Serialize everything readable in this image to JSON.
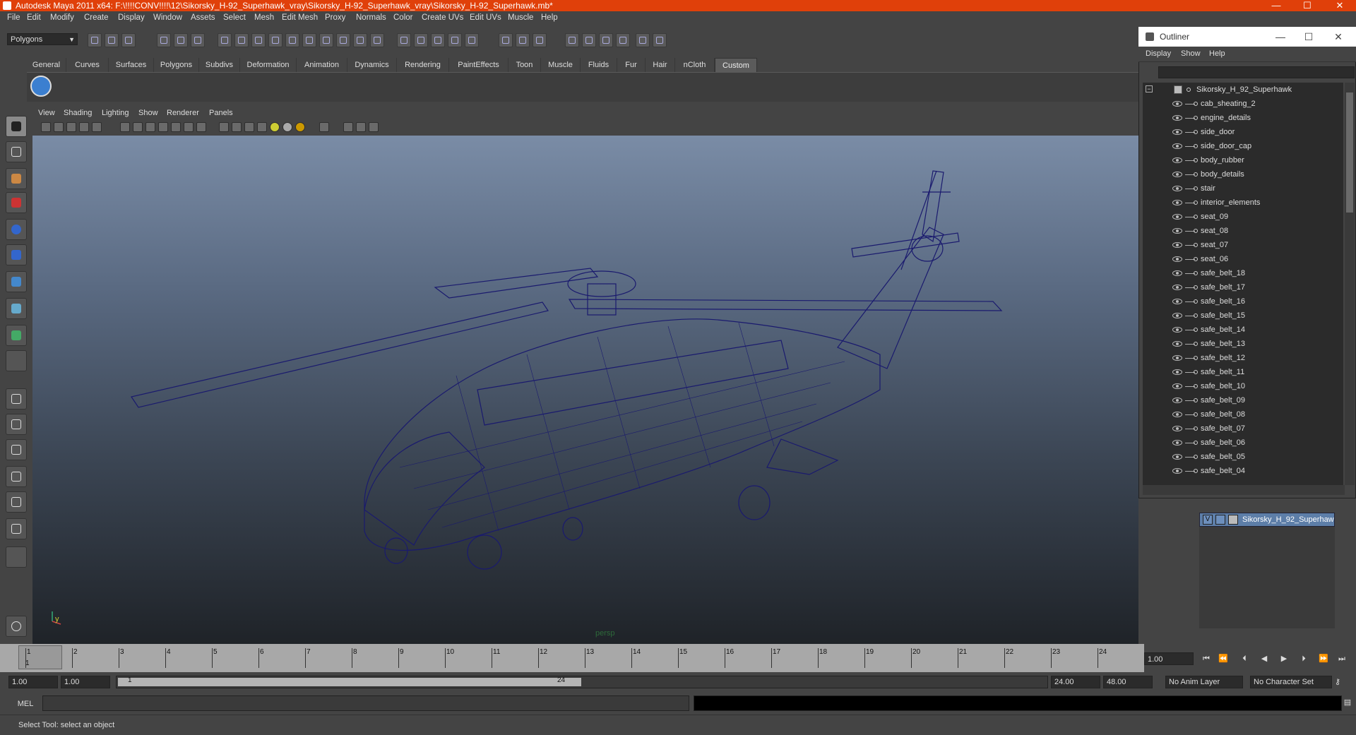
{
  "window": {
    "title": "Autodesk Maya 2011 x64: F:\\!!!!CONV!!!!\\12\\Sikorsky_H-92_Superhawk_vray\\Sikorsky_H-92_Superhawk_vray\\Sikorsky_H-92_Superhawk.mb*",
    "min": "—",
    "max": "☐",
    "close": "✕"
  },
  "menus": [
    "File",
    "Edit",
    "Modify",
    "Create",
    "Display",
    "Window",
    "Assets",
    "Select",
    "Mesh",
    "Edit Mesh",
    "Proxy",
    "Normals",
    "Color",
    "Create UVs",
    "Edit UVs",
    "Muscle",
    "Help"
  ],
  "toolbar": {
    "mode": "Polygons"
  },
  "shelf": {
    "tabs": [
      "General",
      "Curves",
      "Surfaces",
      "Polygons",
      "Subdivs",
      "Deformation",
      "Animation",
      "Dynamics",
      "Rendering",
      "PaintEffects",
      "Toon",
      "Muscle",
      "Fluids",
      "Fur",
      "Hair",
      "nCloth",
      "Custom"
    ],
    "active": "Custom"
  },
  "viewport": {
    "menus": [
      "View",
      "Shading",
      "Lighting",
      "Show",
      "Renderer",
      "Panels"
    ],
    "camera": "persp",
    "axis_y": "y",
    "wire_color": "#1a1a6e"
  },
  "outliner": {
    "title": "Outliner",
    "menus": [
      "Display",
      "Show",
      "Help"
    ],
    "root": "Sikorsky_H_92_Superhawk",
    "items": [
      "cab_sheating_2",
      "engine_details",
      "side_door",
      "side_door_cap",
      "body_rubber",
      "body_details",
      "stair",
      "interior_elements",
      "seat_09",
      "seat_08",
      "seat_07",
      "seat_06",
      "safe_belt_18",
      "safe_belt_17",
      "safe_belt_16",
      "safe_belt_15",
      "safe_belt_14",
      "safe_belt_13",
      "safe_belt_12",
      "safe_belt_11",
      "safe_belt_10",
      "safe_belt_09",
      "safe_belt_08",
      "safe_belt_07",
      "safe_belt_06",
      "safe_belt_05",
      "safe_belt_04"
    ]
  },
  "layers": {
    "visible": "V",
    "name": "Sikorsky_H_92_Superhaw"
  },
  "timeline": {
    "ticks": [
      "1",
      "2",
      "3",
      "4",
      "5",
      "6",
      "7",
      "8",
      "9",
      "10",
      "11",
      "12",
      "13",
      "14",
      "15",
      "16",
      "17",
      "18",
      "19",
      "20",
      "21",
      "22",
      "23",
      "24"
    ],
    "current_frame": "1.00",
    "marker": "1"
  },
  "range": {
    "start": "1.00",
    "inner_start": "1.00",
    "slider_start": "1",
    "slider_end": "24",
    "inner_end": "24.00",
    "end": "48.00",
    "anim_layer": "No Anim Layer",
    "char_set": "No Character Set"
  },
  "command": {
    "mode": "MEL"
  },
  "status": {
    "text": "Select Tool: select an object"
  }
}
